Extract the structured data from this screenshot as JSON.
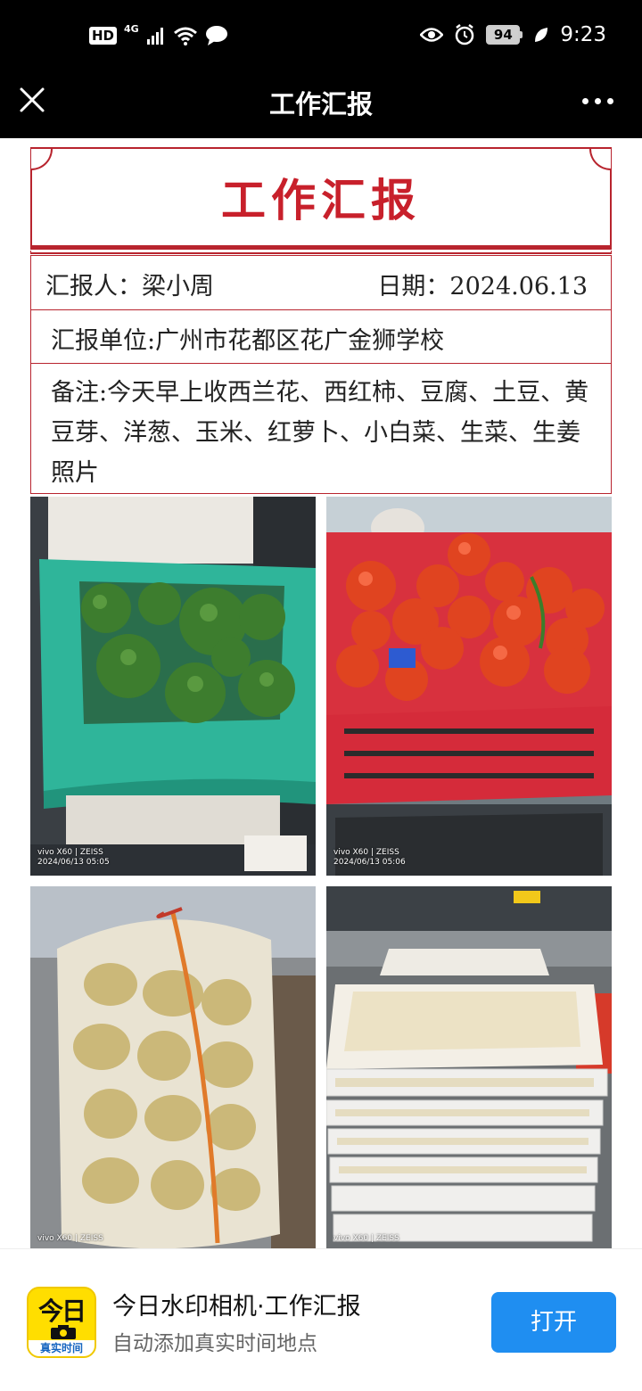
{
  "status_bar": {
    "hd_label": "HD",
    "network_label": "4G",
    "battery_level": "94",
    "time": "9:23"
  },
  "nav": {
    "title": "工作汇报"
  },
  "report": {
    "title": "工作汇报",
    "reporter": "汇报人：梁小周",
    "date": "日期：2024.06.13",
    "unit": "汇报单位:广州市花都区花广金狮学校",
    "note": "备注:今天早上收西兰花、西红柿、豆腐、土豆、黄豆芽、洋葱、玉米、红萝卜、小白菜、生菜、生姜照片"
  },
  "photos": [
    {
      "watermark_brand": "vivo X60 | ZEISS",
      "watermark_time": "2024/06/13 05:05",
      "subject": "broccoli"
    },
    {
      "watermark_brand": "vivo X60 | ZEISS",
      "watermark_time": "2024/06/13 05:06",
      "subject": "tomatoes"
    },
    {
      "watermark_brand": "vivo X60 | ZEISS",
      "watermark_time": "",
      "subject": "potatoes"
    },
    {
      "watermark_brand": "vivo X60 | ZEISS",
      "watermark_time": "",
      "subject": "tofu"
    }
  ],
  "banner": {
    "logo_text": "今日",
    "logo_sub": "真实时间",
    "app_name": "今日水印相机·工作汇报",
    "app_desc": "自动添加真实时间地点",
    "open_label": "打开"
  },
  "colors": {
    "accent_red": "#c8202b",
    "button_blue": "#1f8ef1",
    "logo_yellow": "#ffde00"
  }
}
